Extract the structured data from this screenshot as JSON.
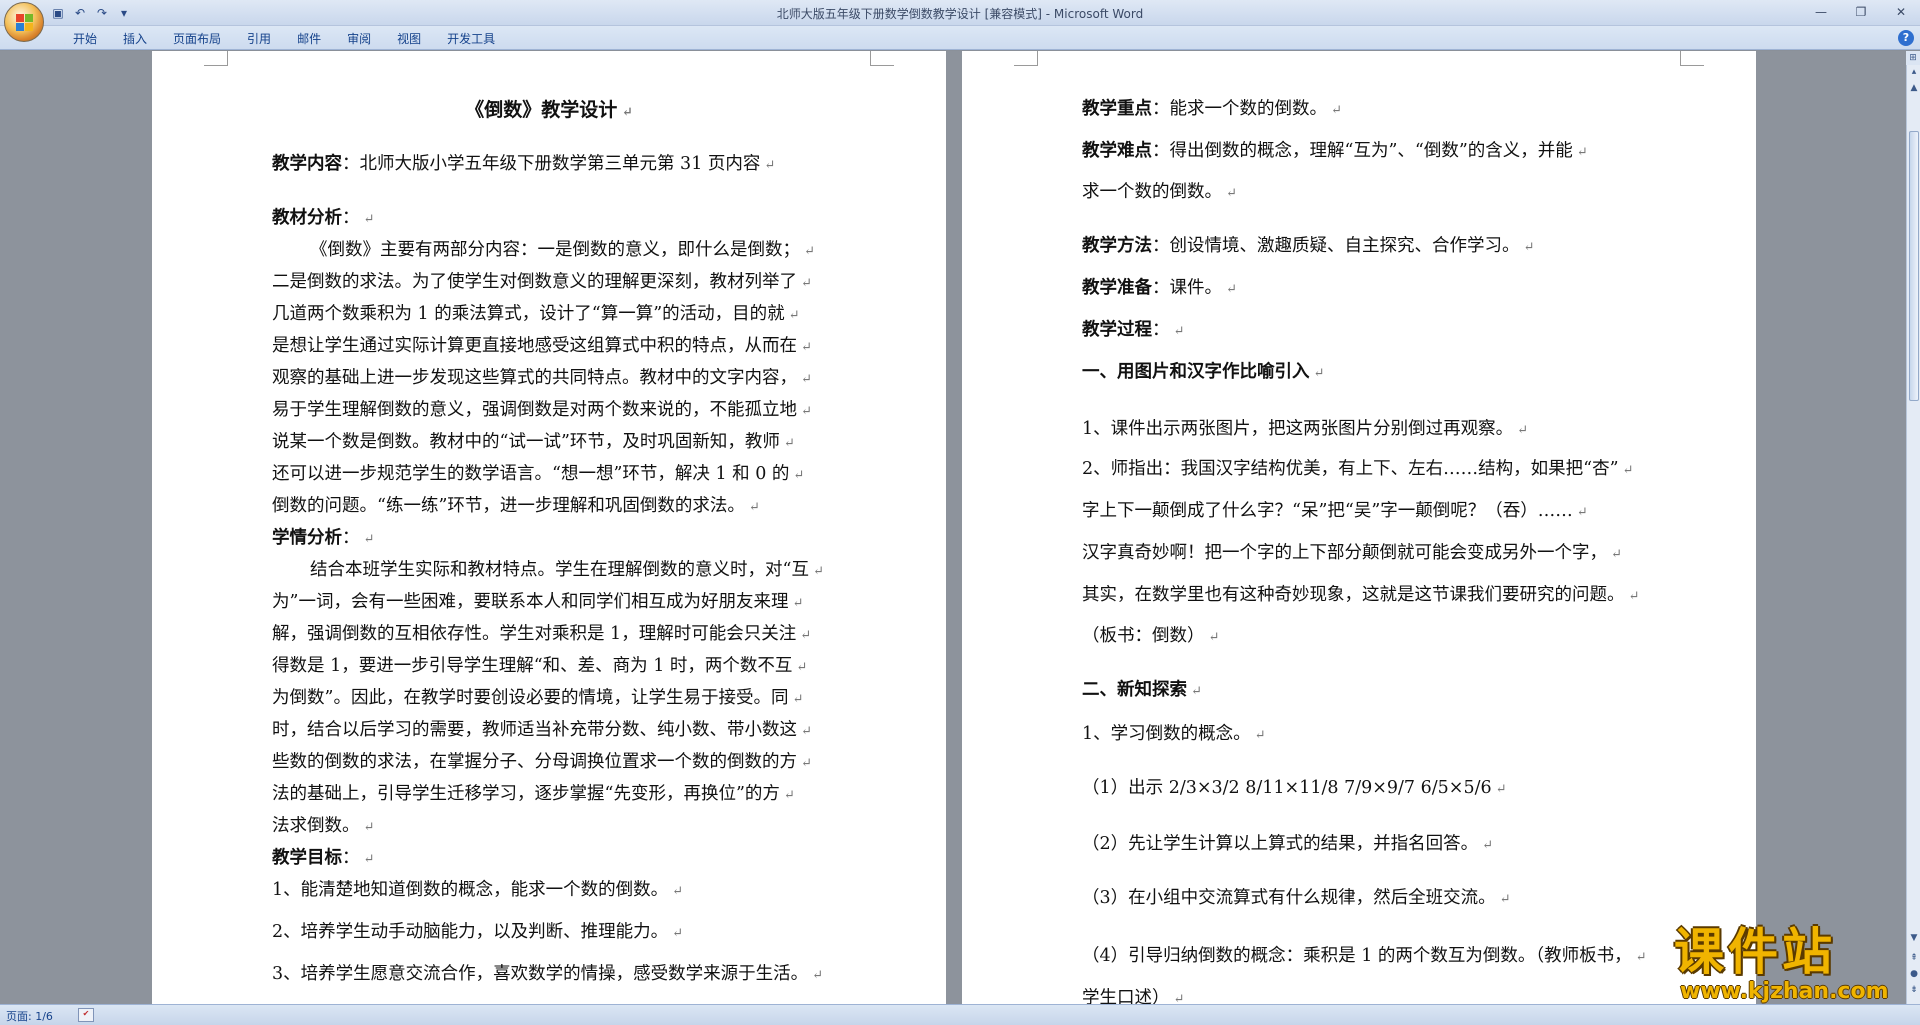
{
  "window": {
    "title": "北师大版五年级下册数学倒数教学设计 [兼容模式] - Microsoft Word"
  },
  "ribbon": {
    "tabs": [
      "开始",
      "插入",
      "页面布局",
      "引用",
      "邮件",
      "审阅",
      "视图",
      "开发工具"
    ]
  },
  "quick_access": [
    "save-icon",
    "undo-icon",
    "redo-icon",
    "customize-icon"
  ],
  "page_left": {
    "lines": [
      {
        "text": "《倒数》教学设计",
        "style": "title"
      },
      {
        "label": "教学内容",
        "text": "：北师大版小学五年级下册数学第三单元第 31 页内容"
      },
      {
        "label": "教材分析",
        "text": "："
      },
      {
        "text": "《倒数》主要有两部分内容：一是倒数的意义，即什么是倒数；"
      },
      {
        "text": "二是倒数的求法。为了使学生对倒数意义的理解更深刻，教材列举了"
      },
      {
        "text": "几道两个数乘积为 1 的乘法算式，设计了“算一算”的活动，目的就"
      },
      {
        "text": "是想让学生通过实际计算更直接地感受这组算式中积的特点，从而在"
      },
      {
        "text": "观察的基础上进一步发现这些算式的共同特点。教材中的文字内容，"
      },
      {
        "text": "易于学生理解倒数的意义，强调倒数是对两个数来说的，不能孤立地"
      },
      {
        "text": "说某一个数是倒数。教材中的“试一试”环节，及时巩固新知，教师"
      },
      {
        "text": "还可以进一步规范学生的数学语言。“想一想”环节，解决 1 和 0 的"
      },
      {
        "text": "倒数的问题。“练一练”环节，进一步理解和巩固倒数的求法。"
      },
      {
        "label": "学情分析",
        "text": "："
      },
      {
        "text": "结合本班学生实际和教材特点。学生在理解倒数的意义时，对“互"
      },
      {
        "text": "为”一词，会有一些困难，要联系本人和同学们相互成为好朋友来理"
      },
      {
        "text": "解，强调倒数的互相依存性。学生对乘积是 1，理解时可能会只关注"
      },
      {
        "text": "得数是 1，要进一步引导学生理解“和、差、商为 1 时，两个数不互"
      },
      {
        "text": "为倒数”。因此，在教学时要创设必要的情境，让学生易于接受。同"
      },
      {
        "text": "时，结合以后学习的需要，教师适当补充带分数、纯小数、带小数这"
      },
      {
        "text": "些数的倒数的求法，在掌握分子、分母调换位置求一个数的倒数的方"
      },
      {
        "text": "法的基础上，引导学生迁移学习，逐步掌握“先变形，再换位”的方"
      },
      {
        "text": "法求倒数。"
      },
      {
        "label": "教学目标",
        "text": "："
      },
      {
        "text": "1、能清楚地知道倒数的概念，能求一个数的倒数。"
      },
      {
        "text": "2、培养学生动手动脑能力，以及判断、推理能力。"
      },
      {
        "text": "3、培养学生愿意交流合作，喜欢数学的情操，感受数学来源于生活。"
      }
    ]
  },
  "page_right": {
    "lines": [
      {
        "label": "教学重点",
        "text": "：能求一个数的倒数。"
      },
      {
        "label": "教学难点",
        "text": "：得出倒数的概念，理解“互为”、“倒数”的含义，并能"
      },
      {
        "text": "求一个数的倒数。"
      },
      {
        "label": "教学方法",
        "text": "：创设情境、激趣质疑、自主探究、合作学习。"
      },
      {
        "label": "教学准备",
        "text": "：课件。"
      },
      {
        "label": "教学过程",
        "text": "："
      },
      {
        "label": "一、用图片和汉字作比喻引入",
        "text": ""
      },
      {
        "text": "1、课件出示两张图片，把这两张图片分别倒过再观察。"
      },
      {
        "text": "2、师指出：我国汉字结构优美，有上下、左右……结构，如果把“杏”"
      },
      {
        "text": "字上下一颠倒成了什么字？“呆”把“吴”字一颠倒呢？（吞）……"
      },
      {
        "text": "汉字真奇妙啊！把一个字的上下部分颠倒就可能会变成另外一个字，"
      },
      {
        "text": "其实，在数学里也有这种奇妙现象，这就是这节课我们要研究的问题。"
      },
      {
        "text": "（板书：倒数）"
      },
      {
        "label": "二、新知探索",
        "text": ""
      },
      {
        "text": "1、学习倒数的概念。"
      },
      {
        "text": "（1）出示 2/3×3/2      8/11×11/8      7/9×9/7      6/5×5/6"
      },
      {
        "text": "（2）先让学生计算以上算式的结果，并指名回答。"
      },
      {
        "text": "（3）在小组中交流算式有什么规律，然后全班交流。"
      },
      {
        "text": "（4）引导归纳倒数的概念：乘积是 1 的两个数互为倒数。（教师板书，"
      },
      {
        "text": "学生口述）"
      }
    ]
  },
  "status": {
    "page": "页面: 1/6"
  },
  "watermark": {
    "name": "课件站",
    "url": "www.kjzhan.com"
  }
}
